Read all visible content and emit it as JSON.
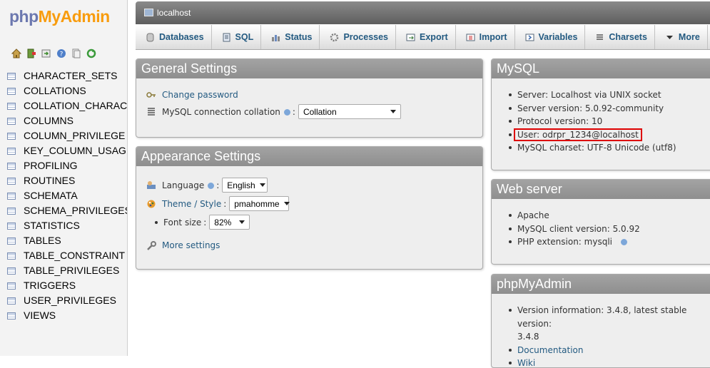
{
  "logo": {
    "php": "php",
    "my": "My",
    "admin": "Admin"
  },
  "nav_icons": [
    "home-icon",
    "exit-icon",
    "query-window-icon",
    "help-icon",
    "docs-icon",
    "reload-icon"
  ],
  "tables": [
    "CHARACTER_SETS",
    "COLLATIONS",
    "COLLATION_CHARAC",
    "COLUMNS",
    "COLUMN_PRIVILEGE",
    "KEY_COLUMN_USAG",
    "PROFILING",
    "ROUTINES",
    "SCHEMATA",
    "SCHEMA_PRIVILEGES",
    "STATISTICS",
    "TABLES",
    "TABLE_CONSTRAINT",
    "TABLE_PRIVILEGES",
    "TRIGGERS",
    "USER_PRIVILEGES",
    "VIEWS"
  ],
  "server": {
    "label": "localhost"
  },
  "tabs": [
    {
      "label": "Databases",
      "icon": "database-icon"
    },
    {
      "label": "SQL",
      "icon": "sql-icon"
    },
    {
      "label": "Status",
      "icon": "status-icon"
    },
    {
      "label": "Processes",
      "icon": "processes-icon"
    },
    {
      "label": "Export",
      "icon": "export-icon"
    },
    {
      "label": "Import",
      "icon": "import-icon"
    },
    {
      "label": "Variables",
      "icon": "variables-icon"
    },
    {
      "label": "Charsets",
      "icon": "charsets-icon"
    },
    {
      "label": "More",
      "icon": "chevron-down-icon"
    }
  ],
  "general": {
    "title": "General Settings",
    "change_password": "Change password",
    "collation_label": "MySQL connection collation",
    "colon": ":",
    "collation_value": "Collation"
  },
  "appearance": {
    "title": "Appearance Settings",
    "language_label": "Language",
    "language_value": "English",
    "theme_label": "Theme / Style",
    "theme_value": "pmahomme",
    "fontsize_label": "Font size",
    "fontsize_value": "82%",
    "more_settings": "More settings",
    "colon": ":"
  },
  "mysql": {
    "title": "MySQL",
    "items": [
      "Server: Localhost via UNIX socket",
      "Server version: 5.0.92-community",
      "Protocol version: 10",
      "User: odrpr_1234@localhost",
      "MySQL charset: UTF-8 Unicode (utf8)"
    ]
  },
  "webserver": {
    "title": "Web server",
    "items": [
      "Apache",
      "MySQL client version: 5.0.92",
      "PHP extension: mysqli"
    ]
  },
  "pma": {
    "title": "phpMyAdmin",
    "version_line1": "Version information: 3.4.8, latest stable version:",
    "version_line2": "3.4.8",
    "documentation": "Documentation",
    "wiki": "Wiki"
  },
  "colors": {
    "link": "#235a81",
    "logo_blue": "#6c78af",
    "logo_orange": "#f89c0e",
    "highlight": "#dd0000"
  }
}
